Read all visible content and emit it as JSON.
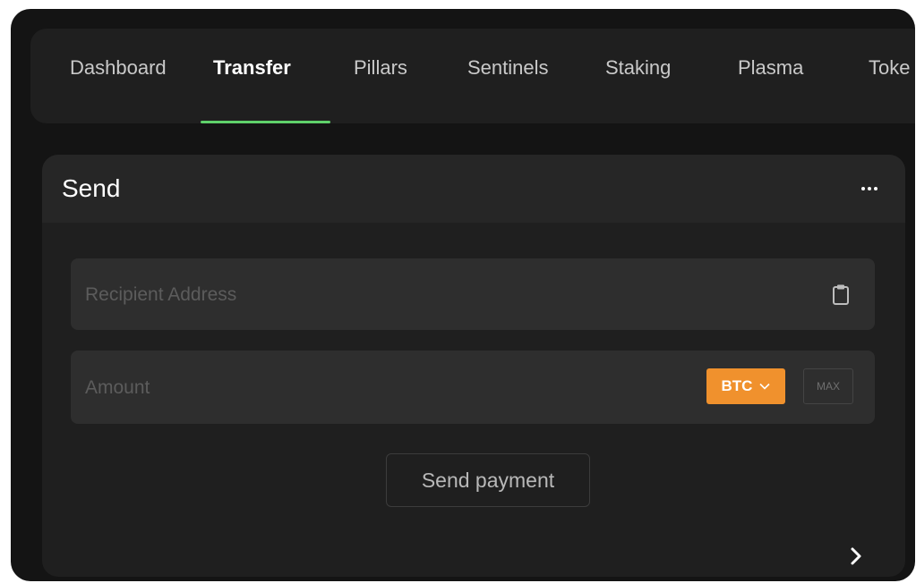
{
  "tabs": [
    {
      "label": "Dashboard",
      "active": false
    },
    {
      "label": "Transfer",
      "active": true
    },
    {
      "label": "Pillars",
      "active": false
    },
    {
      "label": "Sentinels",
      "active": false
    },
    {
      "label": "Staking",
      "active": false
    },
    {
      "label": "Plasma",
      "active": false
    },
    {
      "label": "Toke",
      "active": false
    }
  ],
  "send_panel": {
    "title": "Send",
    "more_icon": "more-horizontal-icon",
    "recipient": {
      "placeholder": "Recipient Address",
      "value": "",
      "paste_icon": "clipboard-icon"
    },
    "amount": {
      "placeholder": "Amount",
      "value": "",
      "token": "BTC",
      "token_icon": "chevron-down-icon",
      "max_label": "MAX"
    },
    "send_button_label": "Send payment",
    "next_icon": "chevron-right-icon"
  },
  "colors": {
    "accent_green": "#5fd16a",
    "token_orange": "#f0912d",
    "background": "#141414",
    "panel": "#1f1f1f"
  }
}
